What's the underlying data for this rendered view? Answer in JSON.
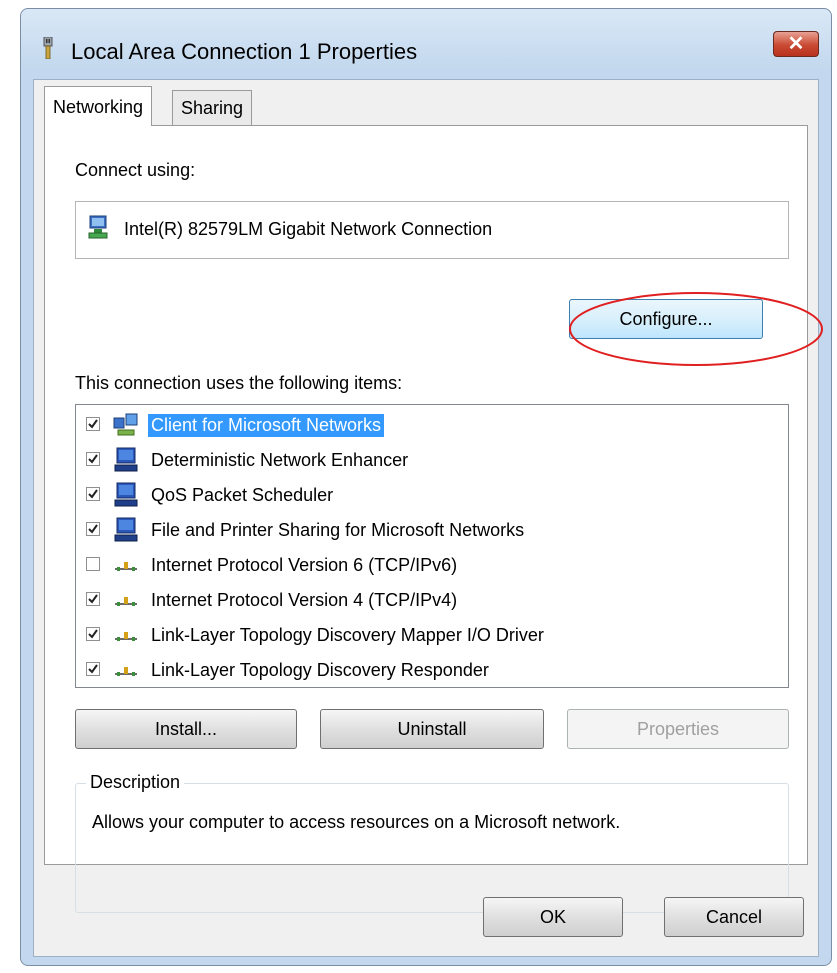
{
  "window": {
    "title": "Local Area Connection 1 Properties",
    "close_label": "✕"
  },
  "tabs": [
    {
      "label": "Networking",
      "active": true
    },
    {
      "label": "Sharing",
      "active": false
    }
  ],
  "connect_using": {
    "label": "Connect using:",
    "adapter": "Intel(R) 82579LM Gigabit Network Connection",
    "adapter_icon": "network-adapter-icon"
  },
  "configure_button": "Configure...",
  "items_section": {
    "label": "This connection uses the following items:",
    "items": [
      {
        "label": "Client for Microsoft Networks",
        "checked": true,
        "selected": true,
        "icon": "client-icon"
      },
      {
        "label": "Deterministic Network Enhancer",
        "checked": true,
        "selected": false,
        "icon": "service-icon"
      },
      {
        "label": "QoS Packet Scheduler",
        "checked": true,
        "selected": false,
        "icon": "service-icon"
      },
      {
        "label": "File and Printer Sharing for Microsoft Networks",
        "checked": true,
        "selected": false,
        "icon": "service-icon"
      },
      {
        "label": "Internet Protocol Version 6 (TCP/IPv6)",
        "checked": false,
        "selected": false,
        "icon": "protocol-icon"
      },
      {
        "label": "Internet Protocol Version 4 (TCP/IPv4)",
        "checked": true,
        "selected": false,
        "icon": "protocol-icon"
      },
      {
        "label": "Link-Layer Topology Discovery Mapper I/O Driver",
        "checked": true,
        "selected": false,
        "icon": "protocol-icon"
      },
      {
        "label": "Link-Layer Topology Discovery Responder",
        "checked": true,
        "selected": false,
        "icon": "protocol-icon"
      }
    ]
  },
  "buttons": {
    "install": "Install...",
    "uninstall": "Uninstall",
    "properties": "Properties",
    "ok": "OK",
    "cancel": "Cancel"
  },
  "description": {
    "title": "Description",
    "text": "Allows your computer to access resources on a Microsoft network."
  },
  "colors": {
    "selection": "#3399ff",
    "callout": "#e02020",
    "close_button": "#c94a33"
  }
}
